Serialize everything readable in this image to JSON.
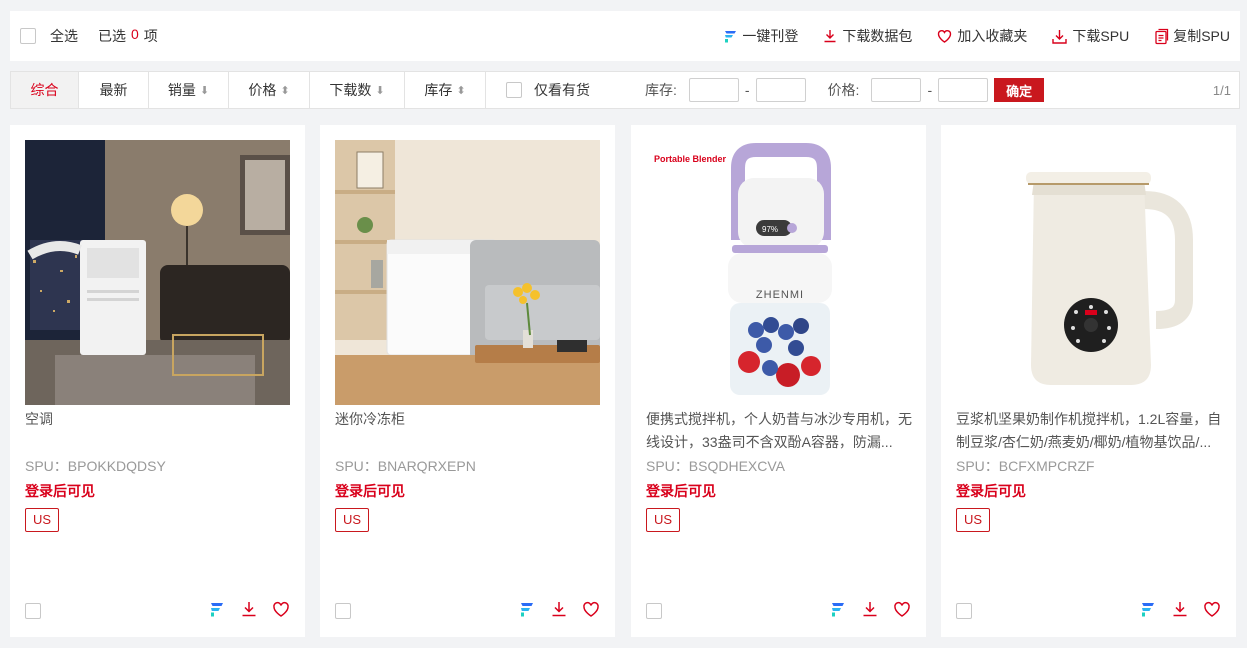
{
  "toolbar": {
    "select_all": "全选",
    "selected_prefix": "已选",
    "selected_count": "0",
    "selected_suffix": "项",
    "actions": [
      {
        "label": "一键刊登",
        "icon": "publish-icon"
      },
      {
        "label": "下载数据包",
        "icon": "download-icon"
      },
      {
        "label": "加入收藏夹",
        "icon": "heart-icon"
      },
      {
        "label": "下载SPU",
        "icon": "download-spu-icon"
      },
      {
        "label": "复制SPU",
        "icon": "copy-icon"
      }
    ]
  },
  "filters": {
    "tabs": [
      {
        "label": "综合",
        "arrow": ""
      },
      {
        "label": "最新",
        "arrow": ""
      },
      {
        "label": "销量",
        "arrow": "⬇"
      },
      {
        "label": "价格",
        "arrow": "⬍"
      },
      {
        "label": "下载数",
        "arrow": "⬇"
      },
      {
        "label": "库存",
        "arrow": "⬍"
      }
    ],
    "in_stock_only": "仅看有货",
    "stock_label": "库存:",
    "price_label": "价格:",
    "dash": "-",
    "confirm": "确定",
    "page_info": "1/1"
  },
  "products": [
    {
      "title": "空调",
      "spu": "SPU：BPOKKDQDSY",
      "login_tip": "登录后可见",
      "tag": "US"
    },
    {
      "title": "迷你冷冻柜",
      "spu": "SPU：BNARQRXEPN",
      "login_tip": "登录后可见",
      "tag": "US"
    },
    {
      "title": "便携式搅拌机，个人奶昔与冰沙专用机，无线设计，33盎司不含双酚A容器，防漏...",
      "spu": "SPU：BSQDHEXCVA",
      "login_tip": "登录后可见",
      "tag": "US",
      "image_text": "Portable Blender",
      "brand": "ZHENMI",
      "display": "97%"
    },
    {
      "title": "豆浆机坚果奶制作机搅拌机，1.2L容量，自制豆浆/杏仁奶/燕麦奶/椰奶/植物基饮品/...",
      "spu": "SPU：BCFXMPCRZF",
      "login_tip": "登录后可见",
      "tag": "US"
    }
  ],
  "colors": {
    "accent": "#d9001b",
    "button": "#c9181e",
    "page_bg": "#f2f3f5"
  }
}
